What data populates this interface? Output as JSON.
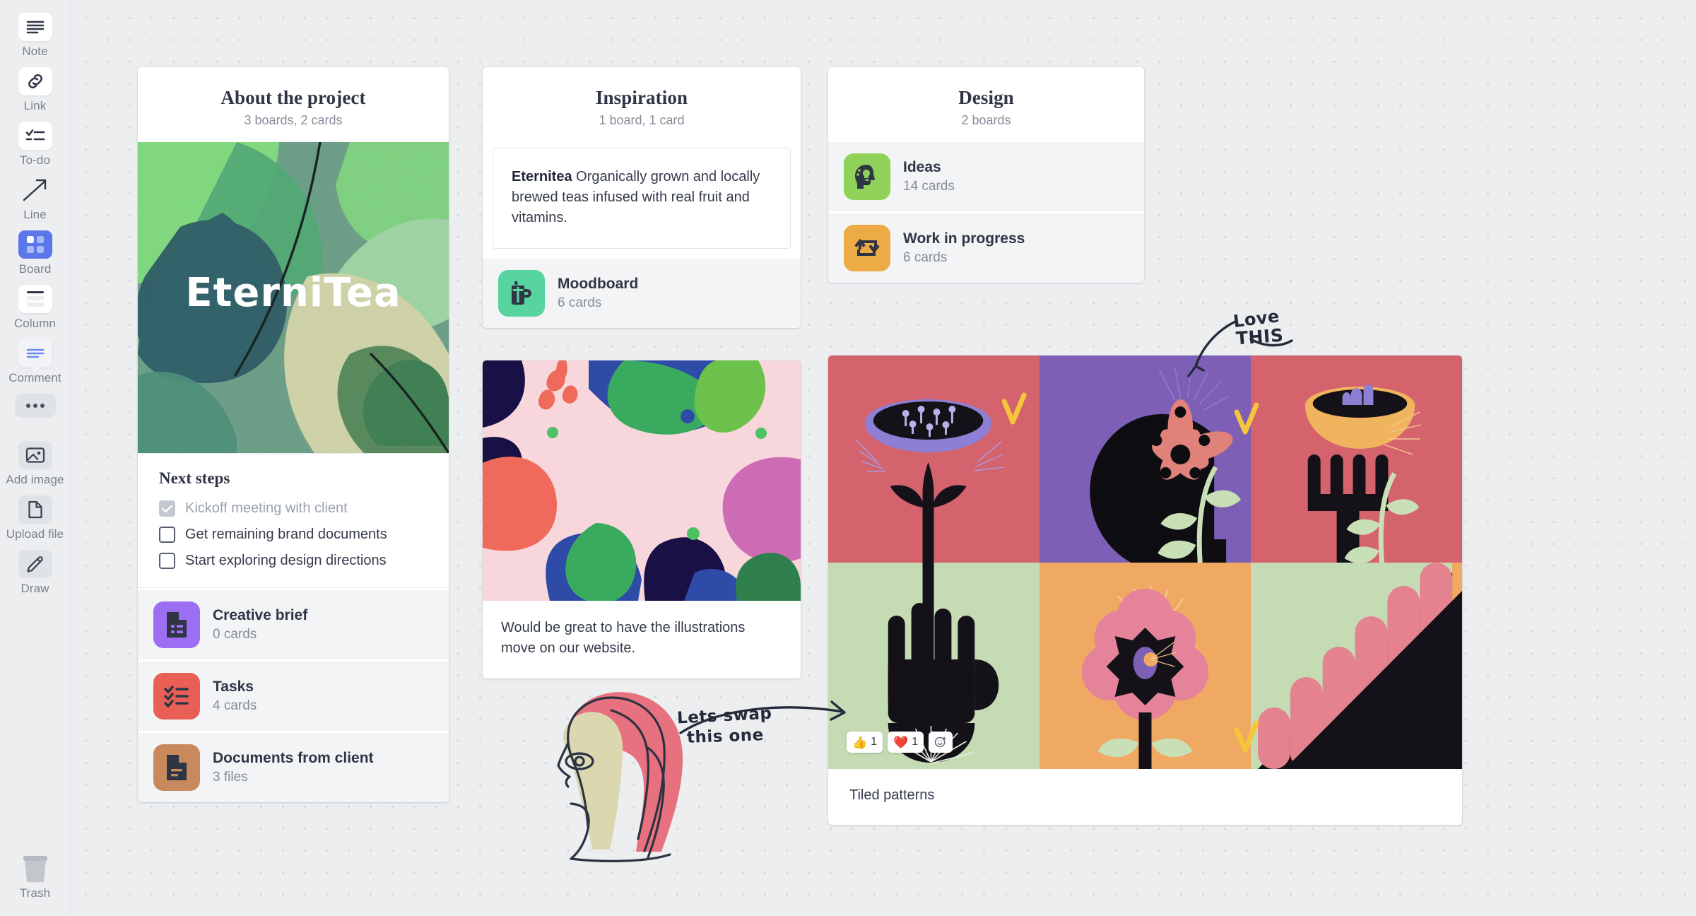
{
  "sidebar": {
    "tools": [
      {
        "label": "Note",
        "icon": "note-icon",
        "state": "default"
      },
      {
        "label": "Link",
        "icon": "link-icon",
        "state": "default"
      },
      {
        "label": "To-do",
        "icon": "todo-icon",
        "state": "default"
      },
      {
        "label": "Line",
        "icon": "line-arrow-icon",
        "state": "plain"
      },
      {
        "label": "Board",
        "icon": "board-icon",
        "state": "active"
      },
      {
        "label": "Column",
        "icon": "column-icon",
        "state": "default"
      },
      {
        "label": "Comment",
        "icon": "comment-icon",
        "state": "default"
      },
      {
        "label": "",
        "icon": "more-dots-icon",
        "state": "grey"
      },
      {
        "label": "Add image",
        "icon": "image-icon",
        "state": "grey"
      },
      {
        "label": "Upload file",
        "icon": "file-icon",
        "state": "grey"
      },
      {
        "label": "Draw",
        "icon": "pencil-icon",
        "state": "grey"
      }
    ],
    "trash": {
      "label": "Trash",
      "icon": "trash-icon"
    }
  },
  "about": {
    "title": "About the project",
    "subtitle": "3 boards, 2 cards",
    "hero": {
      "alt": "EterniTea leaf collage",
      "wordmark": "EterniTea"
    },
    "next_steps": {
      "title": "Next steps",
      "items": [
        {
          "label": "Kickoff meeting with client",
          "done": true
        },
        {
          "label": "Get remaining brand documents",
          "done": false
        },
        {
          "label": "Start exploring design directions",
          "done": false
        }
      ]
    },
    "boards": [
      {
        "name": "Creative brief",
        "count": "0 cards",
        "icon": "document-list-icon",
        "color": "#9b6ef3"
      },
      {
        "name": "Tasks",
        "count": "4 cards",
        "icon": "checklist-icon",
        "color": "#e95f55"
      },
      {
        "name": "Documents from client",
        "count": "3 files",
        "icon": "document-icon",
        "color": "#c88a5c"
      }
    ]
  },
  "inspiration": {
    "title": "Inspiration",
    "subtitle": "1 board, 1 card",
    "note": {
      "lead": "Eternitea",
      "body": " Organically grown and locally brewed teas infused with real fruit and vitamins."
    },
    "boards": [
      {
        "name": "Moodboard",
        "count": "6 cards",
        "icon": "teapot-icon",
        "color": "#57d4a0"
      }
    ],
    "illustration_card": {
      "alt": "Abstract pink and green floral illustration",
      "caption": "Would be great to have the illustrations move on our website."
    }
  },
  "design": {
    "title": "Design",
    "subtitle": "2 boards",
    "boards": [
      {
        "name": "Ideas",
        "count": "14 cards",
        "icon": "head-idea-icon",
        "color": "#8fd159"
      },
      {
        "name": "Work in progress",
        "count": "6 cards",
        "icon": "repeat-icon",
        "color": "#edab45"
      }
    ]
  },
  "tiles": {
    "alt": "Tiled patterns artwork grid, six panels",
    "caption": "Tiled patterns",
    "checkmarks": 3,
    "reactions": [
      {
        "emoji": "thumbs-up-emoji",
        "glyph": "👍",
        "count": "1"
      },
      {
        "emoji": "heart-emoji",
        "glyph": "❤️",
        "count": "1"
      },
      {
        "emoji": "add-reaction-icon",
        "glyph": "",
        "count": ""
      }
    ]
  },
  "annotations": [
    {
      "name": "love-this-note",
      "text_line1": "Love",
      "text_line2": "THIS"
    },
    {
      "name": "lets-swap-note",
      "text_line1": "Lets swap",
      "text_line2": "this one"
    }
  ],
  "drawing": {
    "name": "face-sketch",
    "alt": "Hand-drawn profile of a face with pink hair"
  },
  "colors": {
    "canvas_bg": "#eceef0",
    "dot": "#d5d8dd",
    "card_bg": "#ffffff",
    "row_bg": "#f3f4f6",
    "accent_active": "#5b77ea",
    "ink": "#242b3a",
    "check_yellow": "#f5c63c"
  }
}
